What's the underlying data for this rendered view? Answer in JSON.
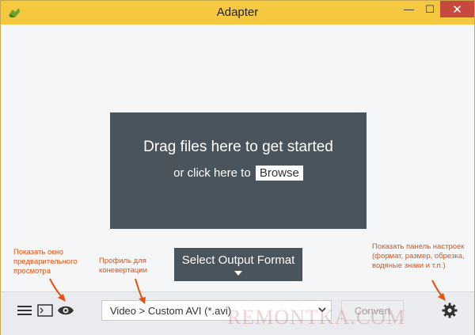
{
  "window": {
    "title": "Adapter",
    "controls": {
      "minimize": "—",
      "maximize": "☐",
      "close": "✕"
    }
  },
  "dropzone": {
    "title": "Drag files here to get started",
    "subtitle": "or click here to",
    "browse_label": "Browse"
  },
  "format_button": {
    "label": "Select Output Format"
  },
  "toolbar": {
    "profile_value": "Video > Custom AVI (*.avi)",
    "convert_label": "Convert"
  },
  "annotations": {
    "preview": "Показать окно предварительного просмотра",
    "profile": "Профиль для коневертации",
    "settings": "Показать панель настроек (формат, размер, обрезка, водяные знаки и т.п.)"
  },
  "watermark": "REMONTKA.COM",
  "colors": {
    "titlebar": "#f5c93f",
    "panel": "#4a545d",
    "annotation": "#e8500e",
    "close": "#c7483f"
  },
  "icons": [
    "app-icon",
    "menu-icon",
    "console-icon",
    "eye-icon",
    "chevron-down-icon",
    "gear-icon"
  ]
}
